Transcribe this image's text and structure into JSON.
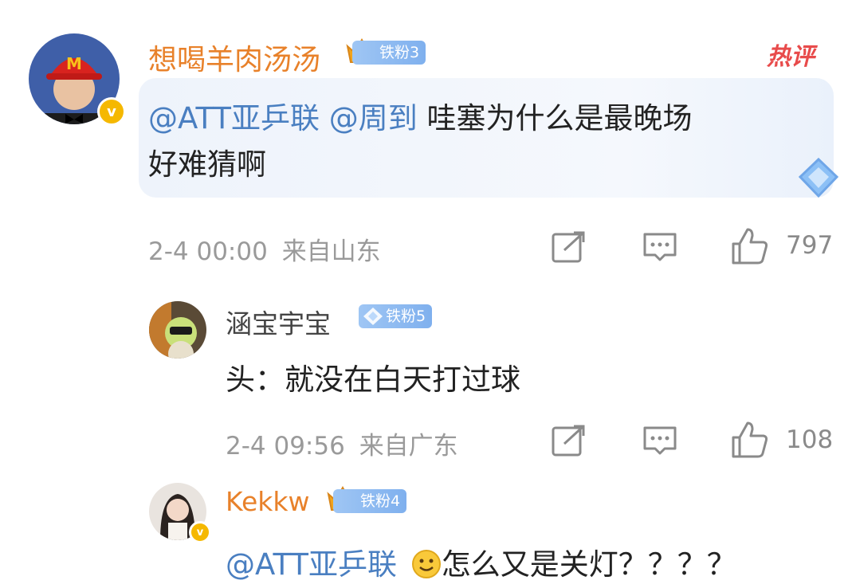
{
  "comments": [
    {
      "username": "想喝羊肉汤汤",
      "fan_badge": "铁粉3",
      "tag": "热评",
      "mention_1": "@ATT亚乒联",
      "mention_2": "@周到",
      "text_line1_rest": "哇塞为什么是最晚场",
      "text_line2": "好难猜啊",
      "timestamp": "2-4 00:00",
      "location": "来自山东",
      "likes": "797"
    },
    {
      "username": "涵宝宇宝",
      "fan_badge": "铁粉5",
      "text": "头：就没在白天打过球",
      "timestamp": "2-4 09:56",
      "location": "来自广东",
      "likes": "108"
    },
    {
      "username": "Kekkw",
      "fan_badge": "铁粉4",
      "mention": "@ATT亚乒联",
      "text": "怎么又是关灯？？？？"
    }
  ],
  "colors": {
    "username_orange": "#e8812a",
    "username_gray": "#444444",
    "mention_blue": "#4a7fc1",
    "meta_gray": "#9a9a9a",
    "hot_red": "#e84b4b",
    "verified_gold": "#f5b800"
  },
  "icons": [
    "crown-icon",
    "diamond-icon",
    "verified-icon",
    "share-icon",
    "comment-icon",
    "like-icon",
    "smile-emoji-icon"
  ]
}
